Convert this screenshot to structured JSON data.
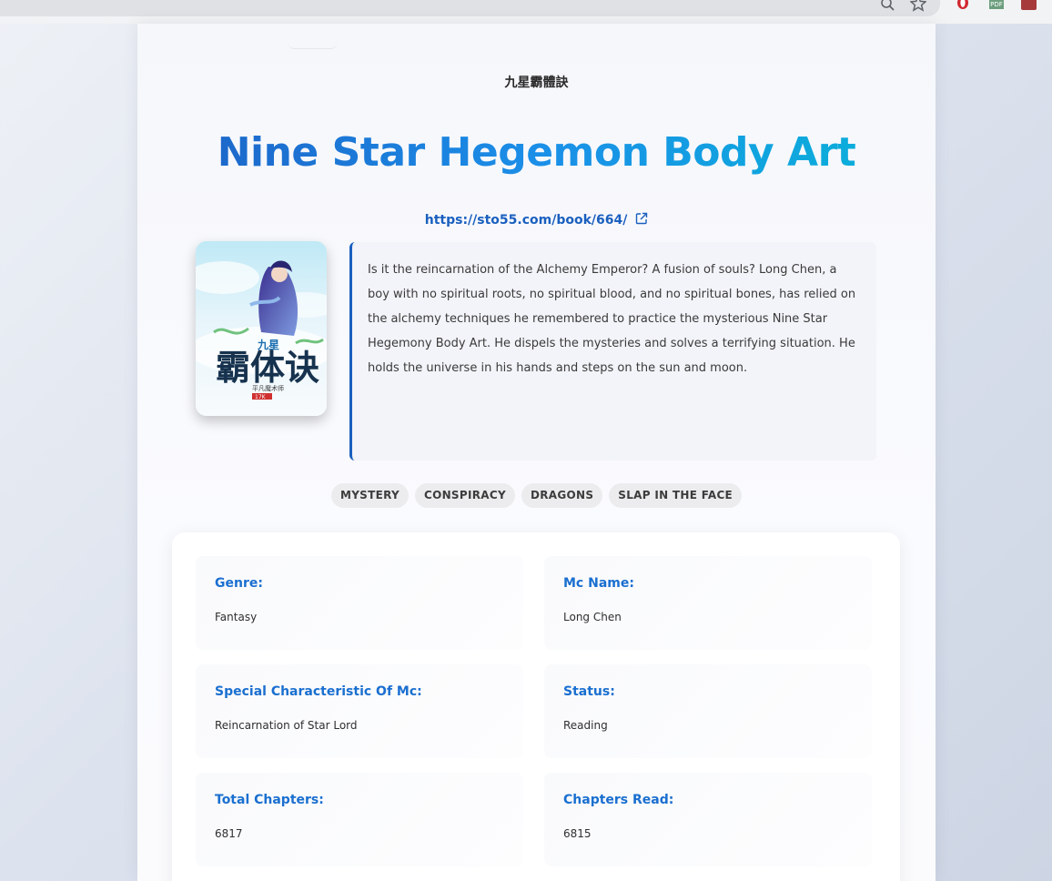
{
  "browser": {
    "icons": [
      "zoom-icon",
      "star-icon",
      "opera-extension-icon",
      "pdf-extension-icon",
      "red-extension-icon"
    ],
    "pdf_label": "PDF"
  },
  "novel": {
    "native_title": "九星霸體訣",
    "title": "Nine Star Hegemon Body Art",
    "url": "https://sto55.com/book/664/",
    "synopsis": "Is it the reincarnation of the Alchemy Emperor? A fusion of souls? Long Chen, a boy with no spiritual roots, no spiritual blood, and no spiritual bones, has relied on the alchemy techniques he remembered to practice the mysterious Nine Star Hegemony Body Art. He dispels the mysteries and solves a terrifying situation. He holds the universe in his hands and steps on the sun and moon.",
    "cover_text": {
      "small": "九星",
      "big": "霸体诀",
      "author": "平凡魔术师",
      "stamp": "17K"
    },
    "tags": [
      "MYSTERY",
      "CONSPIRACY",
      "DRAGONS",
      "SLAP IN THE FACE"
    ],
    "details": [
      {
        "label": "Genre:",
        "value": "Fantasy"
      },
      {
        "label": "Mc Name:",
        "value": "Long Chen"
      },
      {
        "label": "Special Characteristic Of Mc:",
        "value": "Reincarnation of Star Lord"
      },
      {
        "label": "Status:",
        "value": "Reading"
      },
      {
        "label": "Total Chapters:",
        "value": "6817"
      },
      {
        "label": "Chapters Read:",
        "value": "6815"
      }
    ]
  },
  "colors": {
    "accent": "#1a6fd0",
    "title_gradient_start": "#1c5fc4",
    "title_gradient_end": "#08b4d8",
    "tag_bg": "#ececee"
  }
}
